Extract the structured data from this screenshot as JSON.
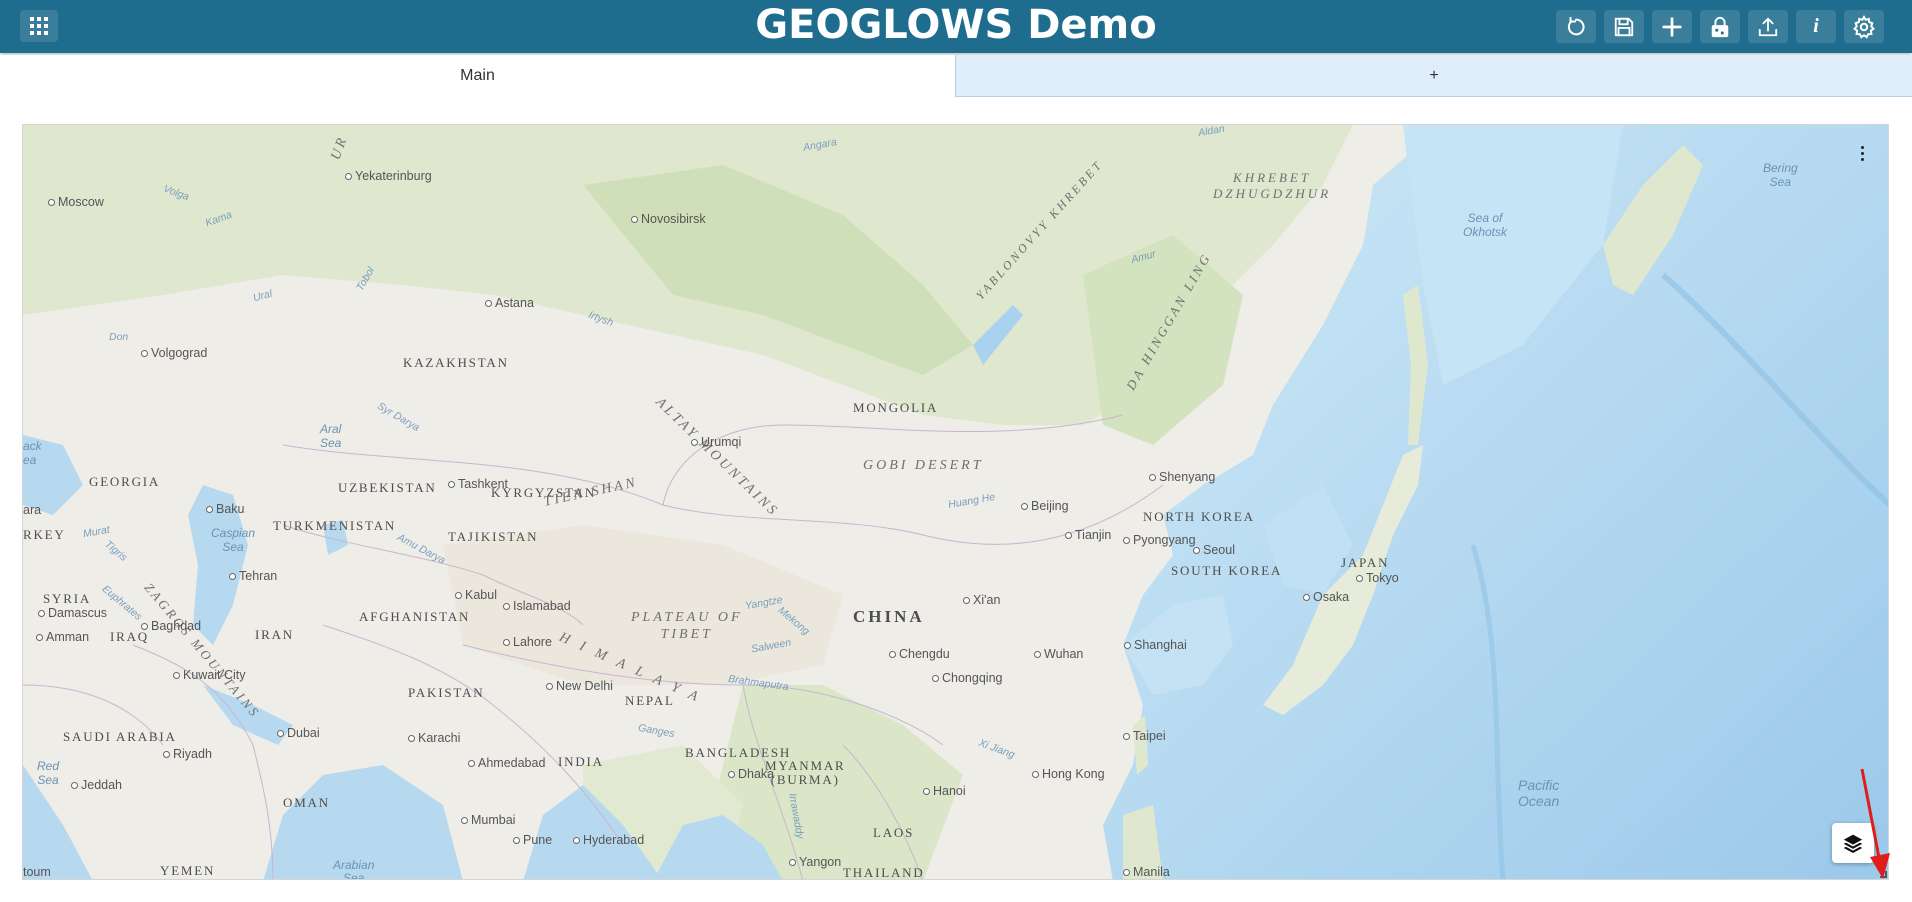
{
  "header": {
    "title": "GEOGLOWS Demo",
    "background": "#1f6d8e",
    "buttons": [
      "apps-grid-icon",
      "refresh-icon",
      "save-icon",
      "add-icon",
      "lock-icon",
      "upload-icon",
      "info-icon",
      "gear-icon"
    ]
  },
  "tabs": [
    {
      "label": "Main",
      "active": true
    },
    {
      "label": "+",
      "active": false
    }
  ],
  "map": {
    "countries": {
      "kazakhstan": "KAZAKHSTAN",
      "mongolia": "MONGOLIA",
      "china": "CHINA",
      "uzbekistan": "UZBEKISTAN",
      "turkmenistan": "TURKMENISTAN",
      "kyrgyzstan": "KYRGYZSTAN",
      "tajikistan": "TAJIKISTAN",
      "afghanistan": "AFGHANISTAN",
      "pakistan": "PAKISTAN",
      "india": "INDIA",
      "nepal": "NEPAL",
      "bangladesh": "BANGLADESH",
      "myanmar": "MYANMAR\n(BURMA)",
      "laos": "LAOS",
      "thailand": "THAILAND",
      "iran": "IRAN",
      "iraq": "IRAQ",
      "syria": "SYRIA",
      "georgia": "GEORGIA",
      "turkey": "RKEY",
      "saudi": "SAUDI ARABIA",
      "oman": "OMAN",
      "yemen": "YEMEN",
      "north_korea": "NORTH KOREA",
      "south_korea": "SOUTH KOREA",
      "japan": "JAPAN"
    },
    "regions": {
      "altay": "ALTAY MOUNTAINS",
      "gobi": "GOBI DESERT",
      "tien_shan": "TIEN SHAN",
      "tibet": "PLATEAU OF\nTIBET",
      "himalaya": "HIMALAYA",
      "zagros": "ZAGROS MOUNTAINS",
      "yablonovyy": "YABLONOVYY KHREBET",
      "da_hinggan": "DA HINGGAN LING",
      "dzhugdzhur": "KHREBET\nDZHUGDZHUR",
      "ural": "UR"
    },
    "cities": {
      "moscow": "Moscow",
      "yekaterinburg": "Yekaterinburg",
      "novosibirsk": "Novosibirsk",
      "astana": "Astana",
      "volgograd": "Volgograd",
      "urumqi": "Urumqi",
      "tashkent": "Tashkent",
      "baku": "Baku",
      "tehran": "Tehran",
      "kabul": "Kabul",
      "islamabad": "Islamabad",
      "lahore": "Lahore",
      "new_delhi": "New Delhi",
      "karachi": "Karachi",
      "ahmedabad": "Ahmedabad",
      "mumbai": "Mumbai",
      "pune": "Pune",
      "hyderabad": "Hyderabad",
      "dhaka": "Dhaka",
      "yangon": "Yangon",
      "hanoi": "Hanoi",
      "hong_kong": "Hong Kong",
      "taipei": "Taipei",
      "manila": "Manila",
      "shanghai": "Shanghai",
      "wuhan": "Wuhan",
      "chengdu": "Chengdu",
      "chongqing": "Chongqing",
      "xian": "Xi'an",
      "beijing": "Beijing",
      "tianjin": "Tianjin",
      "shenyang": "Shenyang",
      "pyongyang": "Pyongyang",
      "seoul": "Seoul",
      "osaka": "Osaka",
      "tokyo": "Tokyo",
      "damascus": "Damascus",
      "baghdad": "Baghdad",
      "amman": "Amman",
      "kuwait_city": "Kuwait City",
      "riyadh": "Riyadh",
      "jeddah": "Jeddah",
      "dubai": "Dubai",
      "ara": "ara",
      "toum": "toum"
    },
    "waters": {
      "bering": "Bering\nSea",
      "okhotsk": "Sea of\nOkhotsk",
      "pacific": "Pacific\nOcean",
      "caspian": "Caspian\nSea",
      "aral": "Aral\nSea",
      "red": "Red\nSea",
      "arabian": "Arabian\nSea",
      "black": "ack\nea"
    },
    "rivers": {
      "volga": "Volga",
      "kama": "Kama",
      "ural": "Ural",
      "don": "Don",
      "tobol": "Tobol",
      "irtysh": "Irtysh",
      "angara": "Angara",
      "aldan": "Aldan",
      "amur": "Amur",
      "syr": "Syr Darya",
      "amu": "Amu Darya",
      "huang": "Huang He",
      "yangtze": "Yangtze",
      "mekong": "Mekong",
      "salween": "Salween",
      "brahmaputra": "Brahmaputra",
      "ganges": "Ganges",
      "xijiang": "Xi Jiang",
      "irrawaddy": "Irrawaddy",
      "euphrates": "Euphrates",
      "tigris": "Tigris",
      "mura": "Murat"
    }
  }
}
